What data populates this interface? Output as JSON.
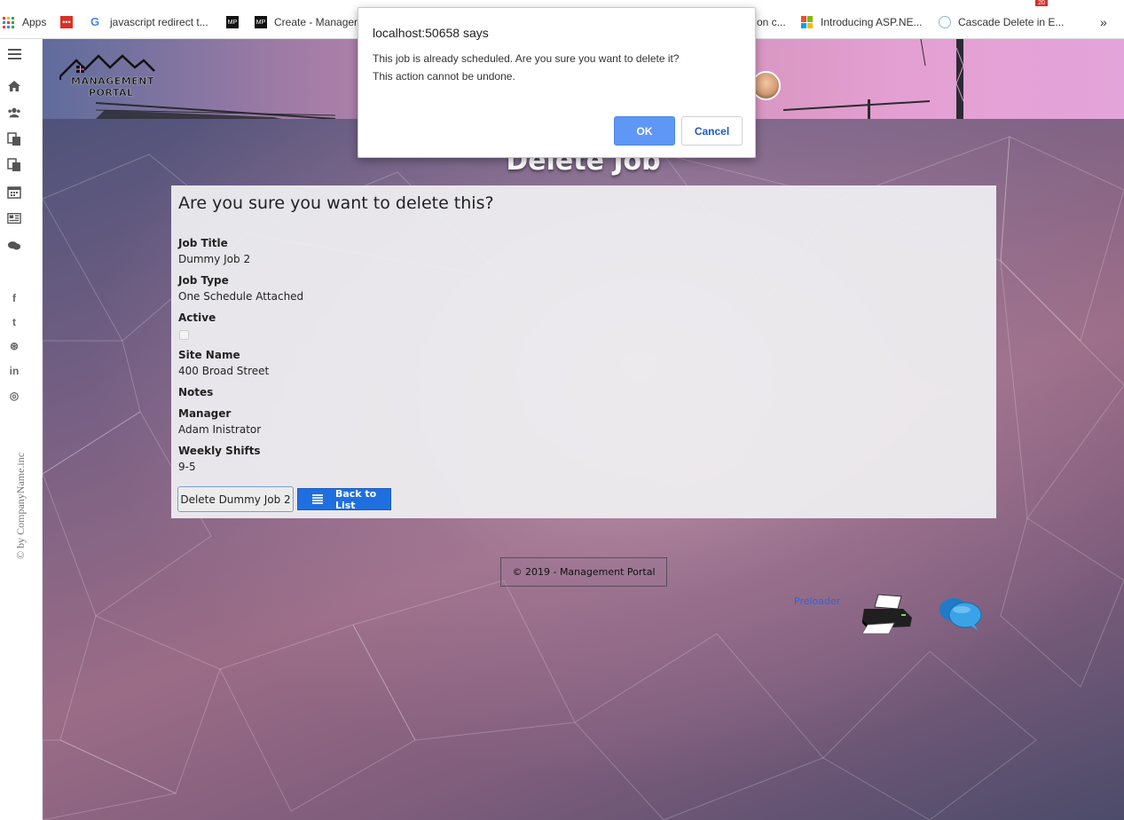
{
  "bookmarks": {
    "items": [
      {
        "label": "Apps",
        "icon": "apps-grid-icon"
      },
      {
        "label": "",
        "icon": "dots-red-icon"
      },
      {
        "label": "javascript redirect t...",
        "icon": "google-icon"
      },
      {
        "label": "",
        "icon": "mp-logo-icon"
      },
      {
        "label": "Create - Manager",
        "icon": "mp-logo-icon"
      },
      {
        "label": "on c...",
        "icon": ""
      },
      {
        "label": "Introducing ASP.NE...",
        "icon": "microsoft-icon"
      },
      {
        "label": "Cascade Delete in E...",
        "icon": "page-icon"
      }
    ],
    "more": "»",
    "badge": "20"
  },
  "sidebar": {
    "icons": [
      "menu-icon",
      "home-icon",
      "users-icon",
      "documents-icon",
      "copy-icon",
      "calendar-icon",
      "news-icon",
      "chat-icon"
    ],
    "social": [
      "f",
      "t",
      "⊛",
      "in",
      "◎"
    ],
    "credit": "© by CompanyName.inc"
  },
  "header": {
    "logo_line1": "MANAGEMENT",
    "logo_line2": "PORTAL"
  },
  "page": {
    "heading": "Delete Job",
    "question": "Are you sure you want to delete this?",
    "fields": {
      "job_title_label": "Job Title",
      "job_title_value": "Dummy Job 2",
      "job_type_label": "Job Type",
      "job_type_value": "One Schedule Attached",
      "active_label": "Active",
      "active_value": false,
      "site_name_label": "Site Name",
      "site_name_value": "400 Broad Street",
      "notes_label": "Notes",
      "notes_value": "",
      "manager_label": "Manager",
      "manager_value": "Adam Inistrator",
      "weekly_shifts_label": "Weekly Shifts",
      "weekly_shifts_value": "9-5"
    },
    "delete_button": "Delete Dummy Job 2",
    "back_button": "Back to List",
    "footer": "© 2019 - Management Portal",
    "preloader_link": "Preloader"
  },
  "dialog": {
    "title": "localhost:50658 says",
    "message_line1": "This job is already scheduled.  Are you sure you want to delete it?",
    "message_line2": "This action cannot be undone.",
    "ok": "OK",
    "cancel": "Cancel",
    "accent_color": "#5e97f6"
  }
}
